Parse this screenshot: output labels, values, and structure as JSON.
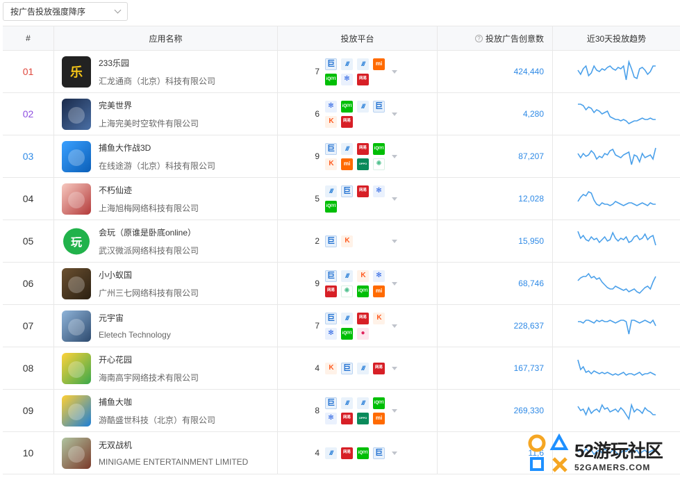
{
  "sort": {
    "label": "按广告投放强度降序"
  },
  "headers": {
    "idx": "#",
    "app": "应用名称",
    "platform": "投放平台",
    "creatives": "投放广告创意数",
    "trend": "近30天投放趋势",
    "help_glyph": "?"
  },
  "platform_legend": {
    "gdt": "巨",
    "csj": "///",
    "ks": "K",
    "mi": "mi",
    "iqy": "iQIYI",
    "bd": "✻",
    "wy": "网易",
    "op": "OPPO",
    "vv": "✺",
    "pk": "●"
  },
  "rows": [
    {
      "rank": "01",
      "rank_color": "#e0493e",
      "name": "233乐园",
      "company": "汇龙通商（北京）科技有限公司",
      "icon": "乐",
      "platform_count": "7",
      "platforms": [
        "gdt",
        "csj",
        "csj",
        "mi",
        "iqy",
        "bd",
        "wy"
      ],
      "creatives": "424,440",
      "trend": [
        18,
        12,
        20,
        24,
        10,
        14,
        24,
        18,
        16,
        20,
        18,
        22,
        24,
        20,
        18,
        22,
        20,
        24,
        4,
        30,
        20,
        8,
        6,
        20,
        22,
        18,
        12,
        16,
        24,
        24
      ]
    },
    {
      "rank": "02",
      "rank_color": "#8e4fe0",
      "name": "完美世界",
      "company": "上海完美时空软件有限公司",
      "icon": "完美世界",
      "platform_count": "6",
      "platforms": [
        "bd",
        "iqy",
        "csj",
        "gdt",
        "ks",
        "wy"
      ],
      "creatives": "4,280",
      "trend": [
        30,
        30,
        28,
        22,
        26,
        24,
        18,
        22,
        20,
        16,
        18,
        20,
        12,
        10,
        8,
        8,
        6,
        8,
        6,
        2,
        4,
        6,
        6,
        8,
        10,
        8,
        8,
        10,
        8,
        8
      ]
    },
    {
      "rank": "03",
      "rank_color": "#2f8ae6",
      "name": "捕鱼大作战3D",
      "company": "在线途游（北京）科技有限公司",
      "icon": "鱼",
      "platform_count": "9",
      "platforms": [
        "gdt",
        "csj",
        "wy",
        "iqy",
        "ks",
        "mi",
        "op",
        "vv"
      ],
      "creatives": "87,207",
      "trend": [
        20,
        14,
        20,
        16,
        18,
        24,
        20,
        12,
        16,
        14,
        20,
        18,
        24,
        26,
        18,
        16,
        14,
        18,
        20,
        22,
        4,
        18,
        16,
        8,
        20,
        14,
        16,
        18,
        12,
        28
      ]
    },
    {
      "rank": "04",
      "rank_color": "#333333",
      "name": "不朽仙迹",
      "company": "上海旭梅网络科技有限公司",
      "icon": "仙",
      "platform_count": "5",
      "platforms": [
        "csj",
        "gdt",
        "wy",
        "bd",
        "iqy"
      ],
      "creatives": "12,028",
      "trend": [
        12,
        18,
        22,
        20,
        26,
        24,
        14,
        8,
        6,
        10,
        8,
        8,
        6,
        8,
        12,
        10,
        8,
        6,
        8,
        10,
        10,
        8,
        6,
        8,
        10,
        8,
        6,
        10,
        8,
        8
      ]
    },
    {
      "rank": "05",
      "rank_color": "#333333",
      "name": "会玩（原谁是卧底online）",
      "company": "武汉微派网络科技有限公司",
      "icon": "玩",
      "platform_count": "2",
      "platforms": [
        "gdt",
        "ks"
      ],
      "creatives": "15,950",
      "trend": [
        30,
        20,
        24,
        18,
        16,
        22,
        18,
        20,
        14,
        18,
        22,
        16,
        18,
        28,
        20,
        16,
        20,
        18,
        22,
        14,
        16,
        22,
        24,
        18,
        20,
        26,
        18,
        22,
        24,
        10
      ]
    },
    {
      "rank": "06",
      "rank_color": "#333333",
      "name": "小小蚁国",
      "company": "广州三七网络科技有限公司",
      "icon": "蚁",
      "platform_count": "9",
      "platforms": [
        "gdt",
        "csj",
        "ks",
        "bd",
        "wy",
        "vv",
        "iqy",
        "mi"
      ],
      "creatives": "68,746",
      "trend": [
        20,
        24,
        26,
        26,
        30,
        24,
        26,
        22,
        24,
        18,
        14,
        10,
        8,
        8,
        12,
        10,
        8,
        6,
        8,
        4,
        6,
        8,
        4,
        2,
        6,
        10,
        12,
        8,
        18,
        26
      ]
    },
    {
      "rank": "07",
      "rank_color": "#333333",
      "name": "元宇宙",
      "company": "Eletech Technology",
      "icon": "宙",
      "platform_count": "7",
      "platforms": [
        "gdt",
        "csj",
        "wy",
        "ks",
        "bd",
        "iqy",
        "pk"
      ],
      "creatives": "228,637",
      "trend": [
        22,
        22,
        20,
        24,
        24,
        22,
        20,
        24,
        22,
        24,
        22,
        22,
        24,
        22,
        20,
        22,
        24,
        24,
        22,
        4,
        24,
        24,
        22,
        20,
        22,
        24,
        22,
        20,
        24,
        16
      ]
    },
    {
      "rank": "08",
      "rank_color": "#333333",
      "name": "开心花园",
      "company": "海南高宇网络技术有限公司",
      "icon": "花园",
      "platform_count": "4",
      "platforms": [
        "ks",
        "gdt",
        "csj",
        "wy"
      ],
      "creatives": "167,737",
      "trend": [
        28,
        14,
        18,
        10,
        12,
        8,
        12,
        10,
        8,
        10,
        8,
        10,
        8,
        6,
        8,
        6,
        8,
        10,
        6,
        8,
        8,
        6,
        8,
        10,
        6,
        8,
        8,
        10,
        8,
        6
      ]
    },
    {
      "rank": "09",
      "rank_color": "#333333",
      "name": "捕鱼大咖",
      "company": "游酷盛世科技（北京）有限公司",
      "icon": "咖",
      "platform_count": "8",
      "platforms": [
        "gdt",
        "csj",
        "csj",
        "iqy",
        "bd",
        "wy",
        "op",
        "mi"
      ],
      "creatives": "269,330",
      "trend": [
        22,
        16,
        18,
        10,
        20,
        12,
        16,
        18,
        14,
        24,
        18,
        20,
        14,
        16,
        18,
        14,
        20,
        16,
        10,
        4,
        24,
        14,
        18,
        16,
        12,
        20,
        16,
        14,
        10,
        10
      ]
    },
    {
      "rank": "10",
      "rank_color": "#333333",
      "name": "无双战机",
      "company": "MINIGAME ENTERTAINMENT LIMITED",
      "icon": "机",
      "platform_count": "4",
      "platforms": [
        "csj",
        "wy",
        "iqy",
        "gdt"
      ],
      "creatives": "11,6",
      "trend": [
        18,
        20,
        16,
        22,
        18,
        20,
        14,
        18,
        20,
        16,
        22,
        18,
        16,
        20,
        18,
        14,
        16,
        20,
        18,
        22,
        16,
        18,
        20,
        14,
        18,
        20,
        16,
        18,
        20,
        18
      ]
    }
  ],
  "watermark": {
    "title": "52游玩社区",
    "url": "52GAMERS.COM"
  }
}
